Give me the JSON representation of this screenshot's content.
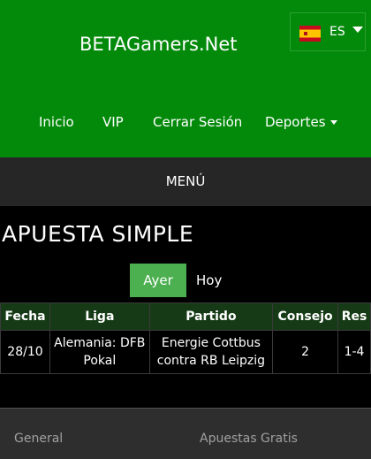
{
  "header": {
    "brand": "BETAGamers.Net",
    "language": {
      "code": "ES",
      "flag_icon": "spain-flag-icon"
    },
    "nav": [
      "Inicio",
      "VIP",
      "Cerrar Sesión",
      "Deportes"
    ]
  },
  "menu_label": "MENÚ",
  "page_title": "APUESTA SIMPLE",
  "day_tabs": {
    "yesterday": "Ayer",
    "today": "Hoy"
  },
  "table": {
    "headers": [
      "Fecha",
      "Liga",
      "Partido",
      "Consejo",
      "Res"
    ],
    "rows": [
      {
        "date": "28/10",
        "league": "Alemania: DFB Pokal",
        "match": "Energie Cottbus contra RB Leipzig",
        "tip": "2",
        "result": "1-4"
      }
    ]
  },
  "footer": {
    "left": "General",
    "right": "Apuestas Gratis"
  },
  "colors": {
    "header_bg": "#048a0b",
    "active_tab": "#4caf50",
    "table_header_bg": "#163a16",
    "menubar_bg": "#262626"
  }
}
